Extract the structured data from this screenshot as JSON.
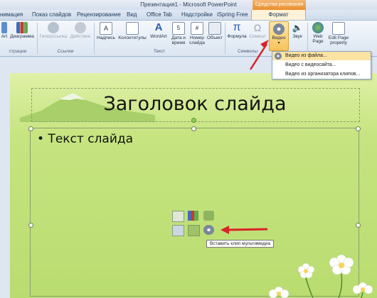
{
  "window": {
    "title": "Презентация1 - Microsoft PowerPoint",
    "contextual_group": "Средства рисования"
  },
  "tabs": [
    "нимация",
    "Показ слайдов",
    "Рецензирование",
    "Вид",
    "Office Tab",
    "Надстройки",
    "iSpring Free",
    "Формат"
  ],
  "ribbon": {
    "buttons": [
      "Art",
      "Диаграмма",
      "Гиперссылка",
      "Действие",
      "Надпись",
      "Колонтитулы",
      "WordArt",
      "Дата и время",
      "Номер слайда",
      "Объект",
      "Формула",
      "Символ",
      "Видео",
      "Звук",
      "Web Page",
      "Edit Page property"
    ],
    "groups": [
      "страции",
      "Ссылки",
      "Текст",
      "Символы"
    ]
  },
  "video_menu": {
    "items": [
      "Видео из файла...",
      "Видео с видеосайта...",
      "Видео из организатора клипов..."
    ]
  },
  "slide": {
    "title": "Заголовок слайда",
    "body": "• Текст слайда",
    "tooltip": "Вставить клип мультимедиа"
  },
  "colors": {
    "accent": "#e98f2e",
    "slide_bg": "#c6e480",
    "arrow": "#d9222a"
  }
}
